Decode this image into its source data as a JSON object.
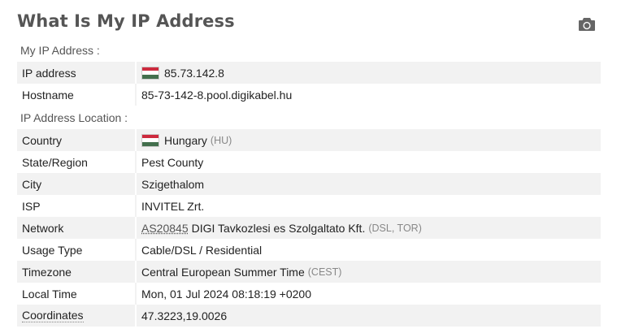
{
  "title": "What Is My IP Address",
  "camera_icon": "camera-icon",
  "ip_section": {
    "label": "My IP Address :",
    "rows": [
      {
        "key": "IP address",
        "value": "85.73.142.8",
        "flag": "hungary-flag-icon"
      },
      {
        "key": "Hostname",
        "value": "85-73-142-8.pool.digikabel.hu"
      }
    ]
  },
  "location_section": {
    "label": "IP Address Location :",
    "country": {
      "key": "Country",
      "value": "Hungary",
      "code": "(HU)",
      "flag": "hungary-flag-icon"
    },
    "state": {
      "key": "State/Region",
      "value": "Pest County"
    },
    "city": {
      "key": "City",
      "value": "Szigethalom"
    },
    "isp": {
      "key": "ISP",
      "value": "INVITEL Zrt."
    },
    "network": {
      "key": "Network",
      "as_link": "AS20845",
      "value": "DIGI Tavkozlesi es Szolgaltato Kft.",
      "tags": "(DSL, TOR)"
    },
    "usage": {
      "key": "Usage Type",
      "value": "Cable/DSL / Residential"
    },
    "timezone": {
      "key": "Timezone",
      "value": "Central European Summer Time",
      "abbr": "(CEST)"
    },
    "local_time": {
      "key": "Local Time",
      "value": "Mon, 01 Jul 2024 08:18:19 +0200"
    },
    "coordinates": {
      "key": "Coordinates",
      "value": "47.3223,19.0026"
    }
  },
  "colors": {
    "flag_red": "#cd2a3e",
    "flag_white": "#ffffff",
    "flag_green": "#436f4d",
    "stripe": "#f2f2f2"
  }
}
